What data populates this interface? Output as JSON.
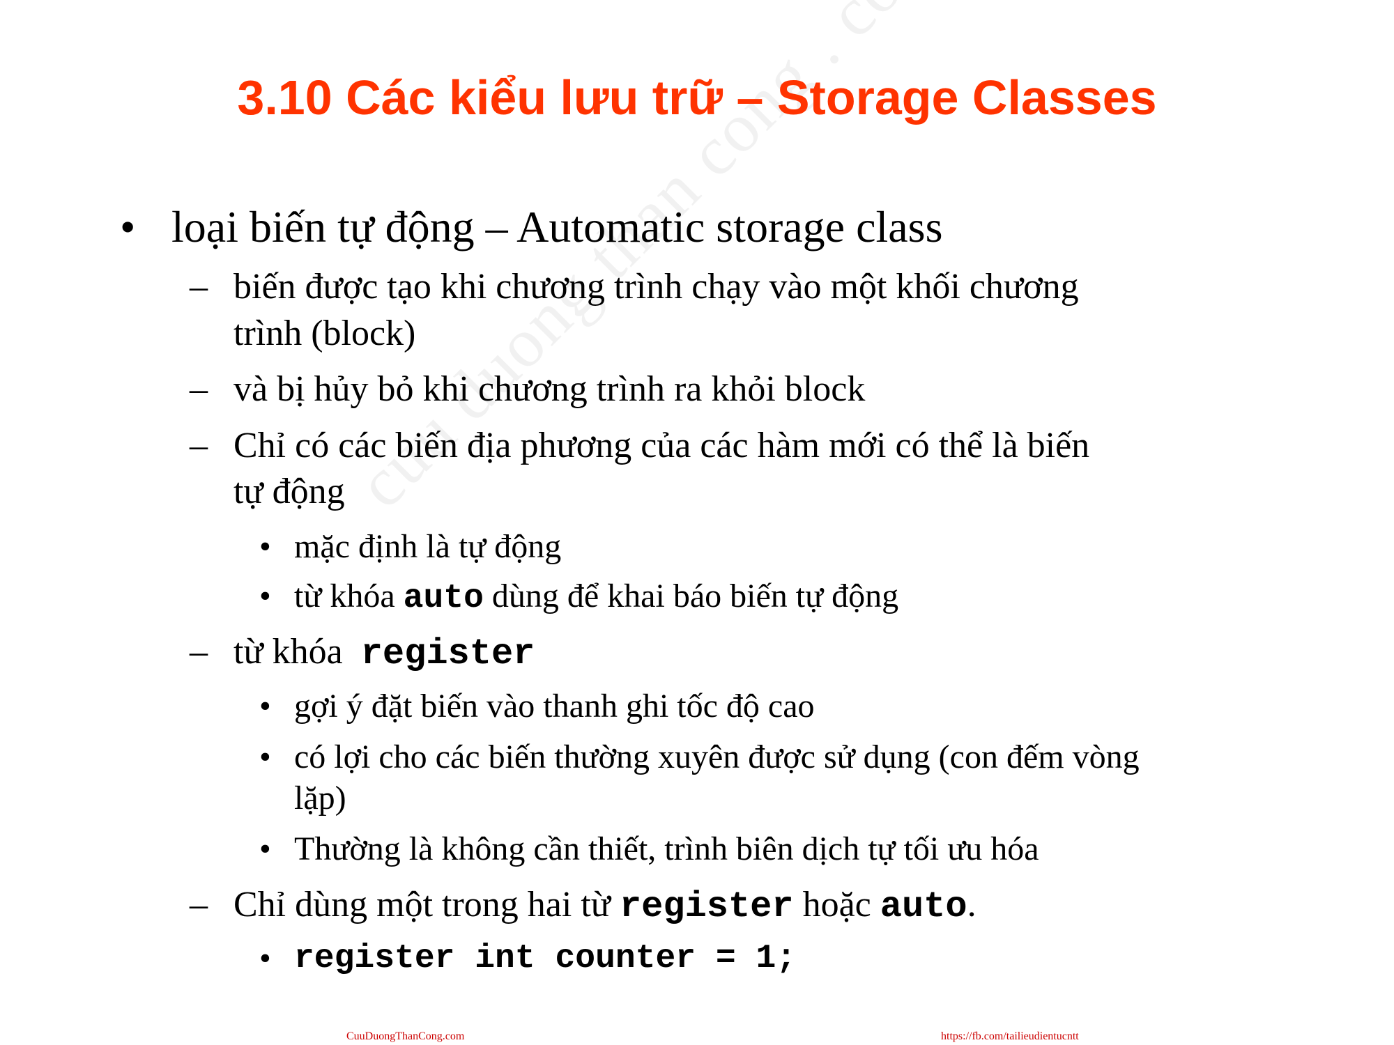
{
  "slide": {
    "title": "3.10 Các kiểu lưu trữ – Storage Classes",
    "watermark": "cuu duong than cong . com"
  },
  "bullets": [
    {
      "marker": "•",
      "text": "loại biến tự động – Automatic storage class"
    },
    {
      "marker": "–",
      "text": "biến được tạo khi chương trình chạy vào một khối chương"
    },
    {
      "text": "trình (block)"
    },
    {
      "marker": "–",
      "text": "và bị hủy bỏ khi chương trình ra khỏi block"
    },
    {
      "marker": "–",
      "text": "Chỉ có các biến địa phương của các hàm mới có thể là biến"
    },
    {
      "text": "tự động"
    },
    {
      "marker": "•",
      "text": "mặc định là tự động"
    },
    {
      "marker": "•",
      "before": "từ khóa ",
      "code": "auto",
      "after": " dùng để khai báo biến tự động"
    },
    {
      "marker": "–",
      "before": "từ khóa  ",
      "code": "register"
    },
    {
      "marker": "•",
      "text": "gợi ý đặt biến vào thanh ghi tốc độ cao"
    },
    {
      "marker": "•",
      "text": "có lợi cho các biến thường xuyên được sử dụng (con đếm vòng"
    },
    {
      "text": "lặp)"
    },
    {
      "marker": "•",
      "text": "Thường là không cần thiết, trình biên dịch tự tối ưu hóa"
    },
    {
      "marker": "–",
      "before": "Chỉ dùng một trong hai từ ",
      "code": "register",
      "middle": " hoặc ",
      "code2": "auto",
      "after": "."
    },
    {
      "marker": "•",
      "code": "register int counter = 1;"
    }
  ],
  "footer": {
    "left": "CuuDuongThanCong.com",
    "right": "https://fb.com/tailieudientucntt"
  },
  "colors": {
    "title": "#ff3300",
    "footer": "#cc0000"
  }
}
